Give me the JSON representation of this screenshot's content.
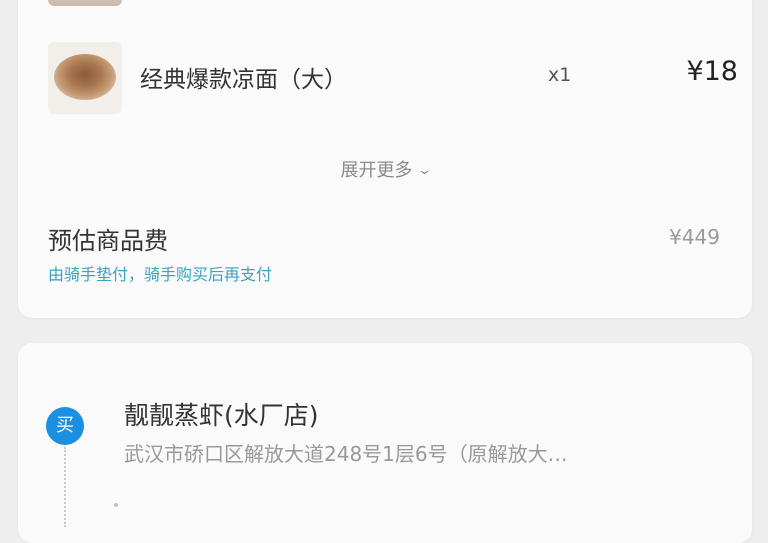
{
  "order_items": {
    "items": [
      {
        "name": "经典爆款凉面（大）",
        "quantity": "x1",
        "price": "¥18"
      }
    ],
    "expand_label": "展开更多",
    "fee_label": "预估商品费",
    "fee_value": "¥449",
    "fee_note": "由骑手垫付，骑手购买后再支付"
  },
  "shop": {
    "badge": "买",
    "name": "靓靓蒸虾(水厂店)",
    "address": "武汉市硚口区解放大道248号1层6号（原解放大…"
  },
  "colors": {
    "badge_blue": "#1d8fe0",
    "note_teal": "#3aa3c2"
  }
}
